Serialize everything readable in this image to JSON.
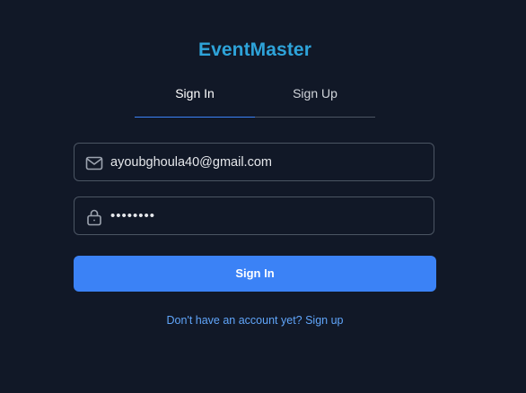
{
  "app": {
    "title": "EventMaster",
    "brand_color": "#2ea3d9"
  },
  "tabs": [
    {
      "label": "Sign In",
      "active": true
    },
    {
      "label": "Sign Up",
      "active": false
    }
  ],
  "form": {
    "email": {
      "value": "ayoubghoula40@gmail.com",
      "icon": "mail-icon"
    },
    "password": {
      "value": "••••••••",
      "icon": "lock-icon"
    },
    "submit_label": "Sign In"
  },
  "footer": {
    "link_text": "Don't have an account yet? Sign up"
  },
  "colors": {
    "background": "#111827",
    "accent": "#3b82f6",
    "link": "#60a5fa",
    "border": "#4b5563"
  }
}
